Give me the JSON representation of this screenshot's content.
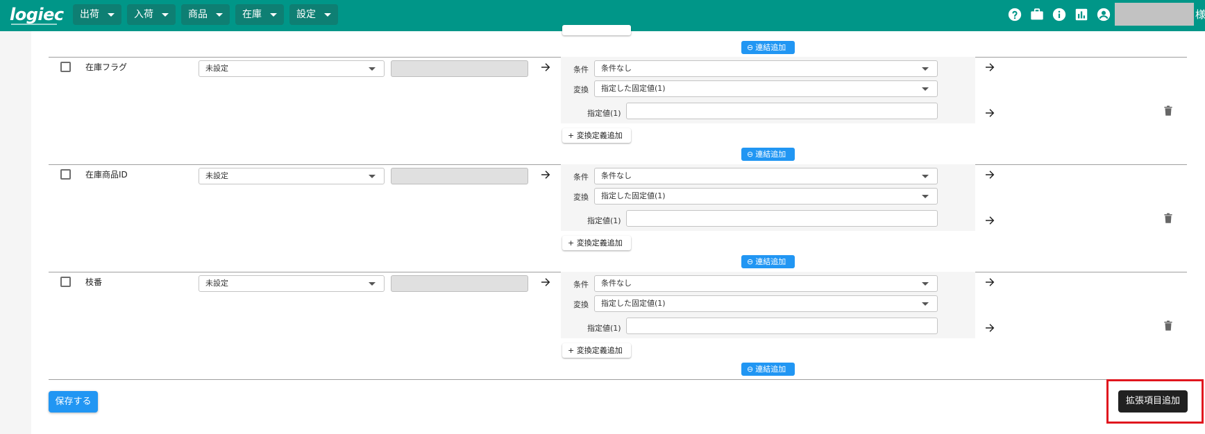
{
  "header": {
    "logo": "logiec",
    "nav": [
      {
        "label": "出荷"
      },
      {
        "label": "入荷"
      },
      {
        "label": "商品"
      },
      {
        "label": "在庫"
      },
      {
        "label": "設定"
      }
    ],
    "icons": [
      "help-icon",
      "briefcase-icon",
      "info-icon",
      "chart-icon",
      "account-icon"
    ],
    "user_suffix": "様"
  },
  "common": {
    "link_add_label": "連結追加",
    "add_conversion_label": "+ 変換定義追加",
    "condition_label": "条件",
    "conversion_label": "変換",
    "fixed_value_label": "指定値(1)"
  },
  "rows": [
    {
      "field": "在庫フラグ",
      "mapping": "未設定",
      "condition": "条件なし",
      "conversion": "指定した固定値(1)",
      "fixed_value": ""
    },
    {
      "field": "在庫商品ID",
      "mapping": "未設定",
      "condition": "条件なし",
      "conversion": "指定した固定値(1)",
      "fixed_value": ""
    },
    {
      "field": "枝番",
      "mapping": "未設定",
      "condition": "条件なし",
      "conversion": "指定した固定値(1)",
      "fixed_value": ""
    }
  ],
  "footer": {
    "save_label": "保存する",
    "add_extension_label": "拡張項目追加"
  },
  "colors": {
    "header": "#009688",
    "primary": "#2196f3",
    "dark_button": "#212121",
    "highlight": "#e0161e"
  }
}
